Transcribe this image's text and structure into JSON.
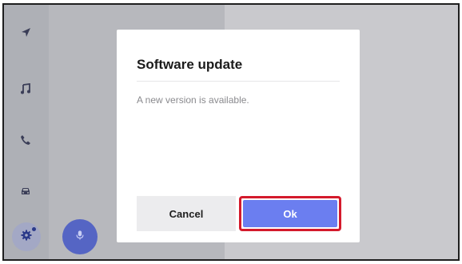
{
  "sidebar": {
    "items": [
      {
        "icon": "navigation-icon"
      },
      {
        "icon": "music-note-icon"
      },
      {
        "icon": "phone-icon"
      },
      {
        "icon": "car-icon"
      },
      {
        "icon": "settings-gear-icon",
        "selected": true
      }
    ]
  },
  "voice_button": {
    "icon": "microphone-icon"
  },
  "dialog": {
    "title": "Software update",
    "message": "A new version is available.",
    "cancel_label": "Cancel",
    "ok_label": "Ok"
  },
  "colors": {
    "accent": "#6b7ef0",
    "highlight_border": "#d41a2c",
    "sidebar_icon": "#3a3d57"
  }
}
